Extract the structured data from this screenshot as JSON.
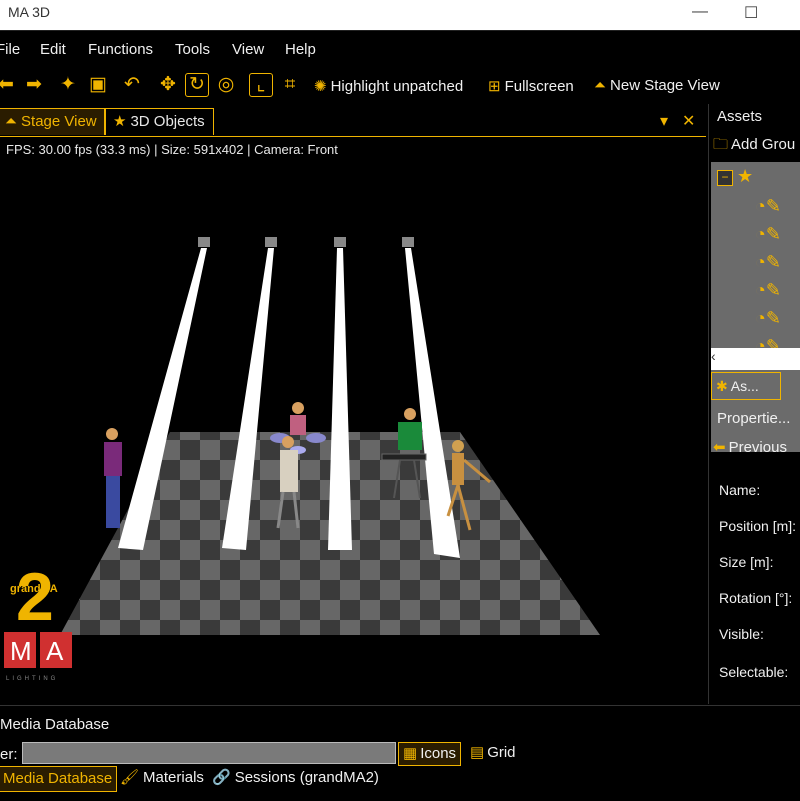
{
  "window": {
    "title": "MA 3D",
    "minimize": "—",
    "maximize": "☐"
  },
  "menu": [
    {
      "label": "File"
    },
    {
      "label": "Edit"
    },
    {
      "label": "Functions"
    },
    {
      "label": "Tools"
    },
    {
      "label": "View"
    },
    {
      "label": "Help"
    }
  ],
  "toolbar": {
    "highlight_unpatched": "Highlight unpatched",
    "fullscreen": "Fullscreen",
    "new_stage_view": "New Stage View"
  },
  "tabs": [
    {
      "label": "Stage View",
      "active": true,
      "icon": "stage-icon"
    },
    {
      "label": "3D Objects",
      "active": false,
      "icon": "star-icon"
    }
  ],
  "status_line": "FPS: 30.00 fps (33.3 ms) | Size: 591x402 | Camera: Front",
  "logo": {
    "number": "2",
    "brand": "grandMA",
    "letters": [
      "M",
      "A"
    ],
    "sub": "LIGHTING"
  },
  "assets_panel": {
    "header": "Assets",
    "add_group": "Add Grou",
    "assets_tab": "As...",
    "properties_title": "Propertie...",
    "previous": "Previous",
    "property_labels": [
      "Name:",
      "Position [m]:",
      "Size [m]:",
      "Rotation [°]:",
      "Visible:",
      "Selectable:"
    ]
  },
  "bottom": {
    "title": "Media Database",
    "filter_label": "er:",
    "filter_value": "",
    "view_icons": "Icons",
    "view_grid": "Grid",
    "tabs": [
      {
        "label": "Media Database",
        "active": true
      },
      {
        "label": "Materials",
        "active": false
      },
      {
        "label": "Sessions (grandMA2)",
        "active": false
      }
    ]
  },
  "colors": {
    "accent": "#f0b400",
    "floor_dark": "#3a3a3a",
    "floor_light": "#6a6a6a",
    "beam": "#ffffff"
  }
}
